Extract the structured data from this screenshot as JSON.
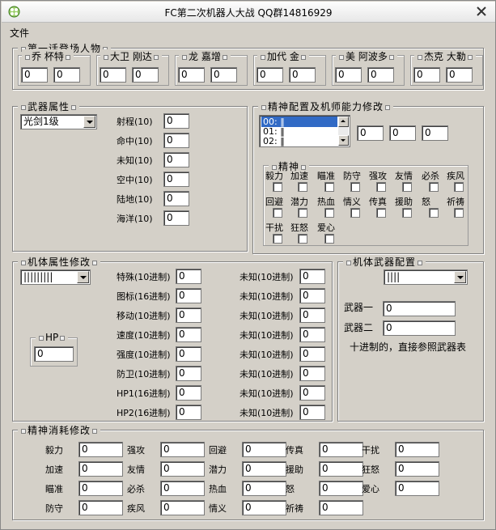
{
  "window": {
    "title": "FC第二次机器人大战 QQ群14816929"
  },
  "menu": {
    "file": "文件"
  },
  "characters": {
    "legend": "第一话登场人物",
    "items": [
      {
        "name": "乔 杯特",
        "v1": "0",
        "v2": "0"
      },
      {
        "name": "大卫 刚达",
        "v1": "0",
        "v2": "0"
      },
      {
        "name": "龙 嘉增",
        "v1": "0",
        "v2": "0"
      },
      {
        "name": "加代 金",
        "v1": "0",
        "v2": "0"
      },
      {
        "name": "美 阿波多",
        "v1": "0",
        "v2": "0"
      },
      {
        "name": "杰克 大勒",
        "v1": "0",
        "v2": "0"
      }
    ]
  },
  "weapon": {
    "legend": "武器属性",
    "selected": "光剑1级",
    "fields": [
      {
        "label": "射程(10)",
        "value": "0"
      },
      {
        "label": "命中(10)",
        "value": "0"
      },
      {
        "label": "未知(10)",
        "value": "0"
      },
      {
        "label": "空中(10)",
        "value": "0"
      },
      {
        "label": "陆地(10)",
        "value": "0"
      },
      {
        "label": "海洋(10)",
        "value": "0"
      }
    ]
  },
  "spirit_config": {
    "legend": "精神配置及机师能力修改",
    "list": [
      "00: ‖",
      "01: ‖",
      "02: ‖"
    ],
    "values": [
      "0",
      "0",
      "0"
    ],
    "spirit_legend": "精神",
    "row1": [
      "毅力",
      "加速",
      "瞄准",
      "防守",
      "强攻",
      "友情",
      "必杀",
      "疾风"
    ],
    "row2": [
      "回避",
      "潜力",
      "热血",
      "情义",
      "传真",
      "援助",
      "怒",
      "祈祷"
    ],
    "row3": [
      "干扰",
      "狂怒",
      "爱心"
    ]
  },
  "mecha": {
    "legend": "机体属性修改",
    "selected": "|||||||||",
    "hp_label": "HP",
    "hp_value": "0",
    "left": [
      {
        "label": "特殊(10进制)",
        "value": "0"
      },
      {
        "label": "图标(16进制)",
        "value": "0"
      },
      {
        "label": "移动(10进制)",
        "value": "0"
      },
      {
        "label": "速度(10进制)",
        "value": "0"
      },
      {
        "label": "强度(10进制)",
        "value": "0"
      },
      {
        "label": "防卫(10进制)",
        "value": "0"
      },
      {
        "label": "HP1(16进制)",
        "value": "0"
      },
      {
        "label": "HP2(16进制)",
        "value": "0"
      }
    ],
    "right": [
      {
        "label": "未知(10进制)",
        "value": "0"
      },
      {
        "label": "未知(10进制)",
        "value": "0"
      },
      {
        "label": "未知(10进制)",
        "value": "0"
      },
      {
        "label": "未知(10进制)",
        "value": "0"
      },
      {
        "label": "未知(10进制)",
        "value": "0"
      },
      {
        "label": "未知(10进制)",
        "value": "0"
      },
      {
        "label": "未知(10进制)",
        "value": "0"
      },
      {
        "label": "未知(10进制)",
        "value": "0"
      }
    ]
  },
  "mecha_weapon": {
    "legend": "机体武器配置",
    "selected": "||||",
    "w1_label": "武器一",
    "w1_value": "0",
    "w2_label": "武器二",
    "w2_value": "0",
    "note": "十进制的，直接参照武器表"
  },
  "spirit_cost": {
    "legend": "精神消耗修改",
    "cols": [
      [
        {
          "label": "毅力",
          "value": "0"
        },
        {
          "label": "加速",
          "value": "0"
        },
        {
          "label": "瞄准",
          "value": "0"
        },
        {
          "label": "防守",
          "value": "0"
        }
      ],
      [
        {
          "label": "强攻",
          "value": "0"
        },
        {
          "label": "友情",
          "value": "0"
        },
        {
          "label": "必杀",
          "value": "0"
        },
        {
          "label": "疾风",
          "value": "0"
        }
      ],
      [
        {
          "label": "回避",
          "value": "0"
        },
        {
          "label": "潜力",
          "value": "0"
        },
        {
          "label": "热血",
          "value": "0"
        },
        {
          "label": "情义",
          "value": "0"
        }
      ],
      [
        {
          "label": "传真",
          "value": "0"
        },
        {
          "label": "援助",
          "value": "0"
        },
        {
          "label": "怒",
          "value": "0"
        },
        {
          "label": "祈祷",
          "value": "0"
        }
      ],
      [
        {
          "label": "干扰",
          "value": "0"
        },
        {
          "label": "狂怒",
          "value": "0"
        },
        {
          "label": "爱心",
          "value": "0"
        }
      ]
    ]
  }
}
